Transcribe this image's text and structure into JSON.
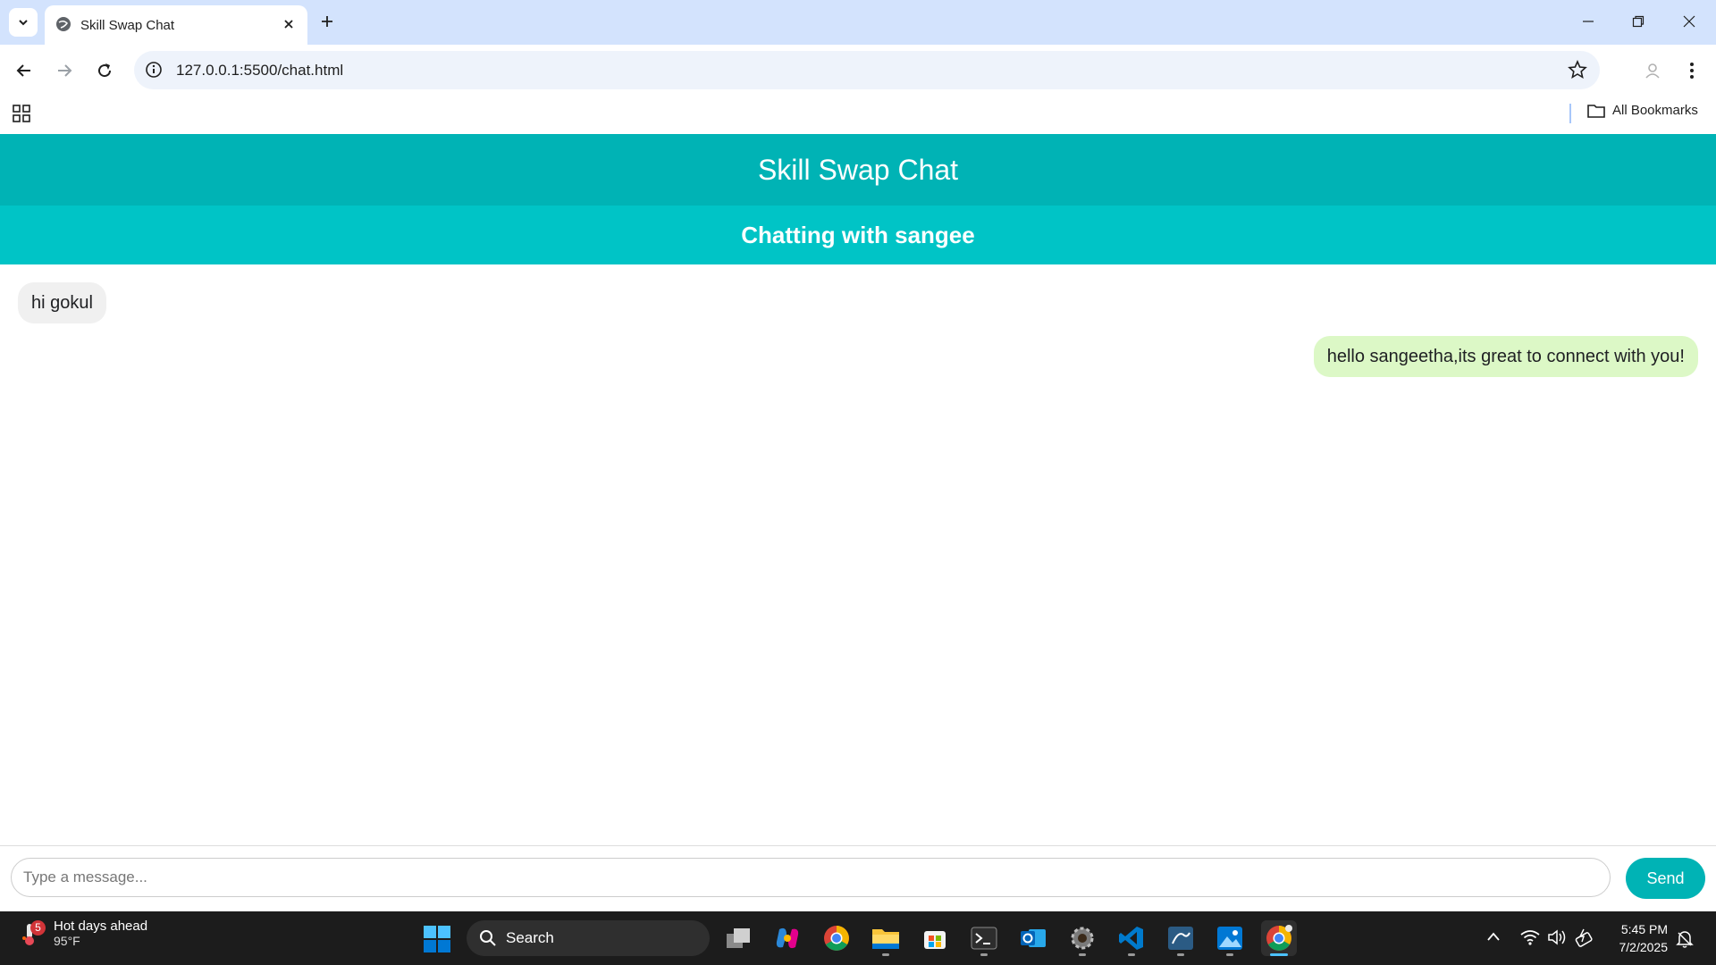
{
  "browser": {
    "tab_title": "Skill Swap Chat",
    "url": "127.0.0.1:5500/chat.html",
    "bookmarks_label": "All Bookmarks"
  },
  "app": {
    "title": "Skill Swap Chat",
    "chat_header": "Chatting with sangee",
    "accent_color": "#00b3b5"
  },
  "messages": [
    {
      "text": "hi gokul",
      "direction": "received"
    },
    {
      "text": "hello sangeetha,its great to connect with you!",
      "direction": "sent"
    }
  ],
  "composer": {
    "placeholder": "Type a message...",
    "send_label": "Send"
  },
  "taskbar": {
    "weather_badge": "5",
    "weather_title": "Hot days ahead",
    "weather_temp": "95°F",
    "search_label": "Search",
    "time": "5:45 PM",
    "date": "7/2/2025"
  }
}
